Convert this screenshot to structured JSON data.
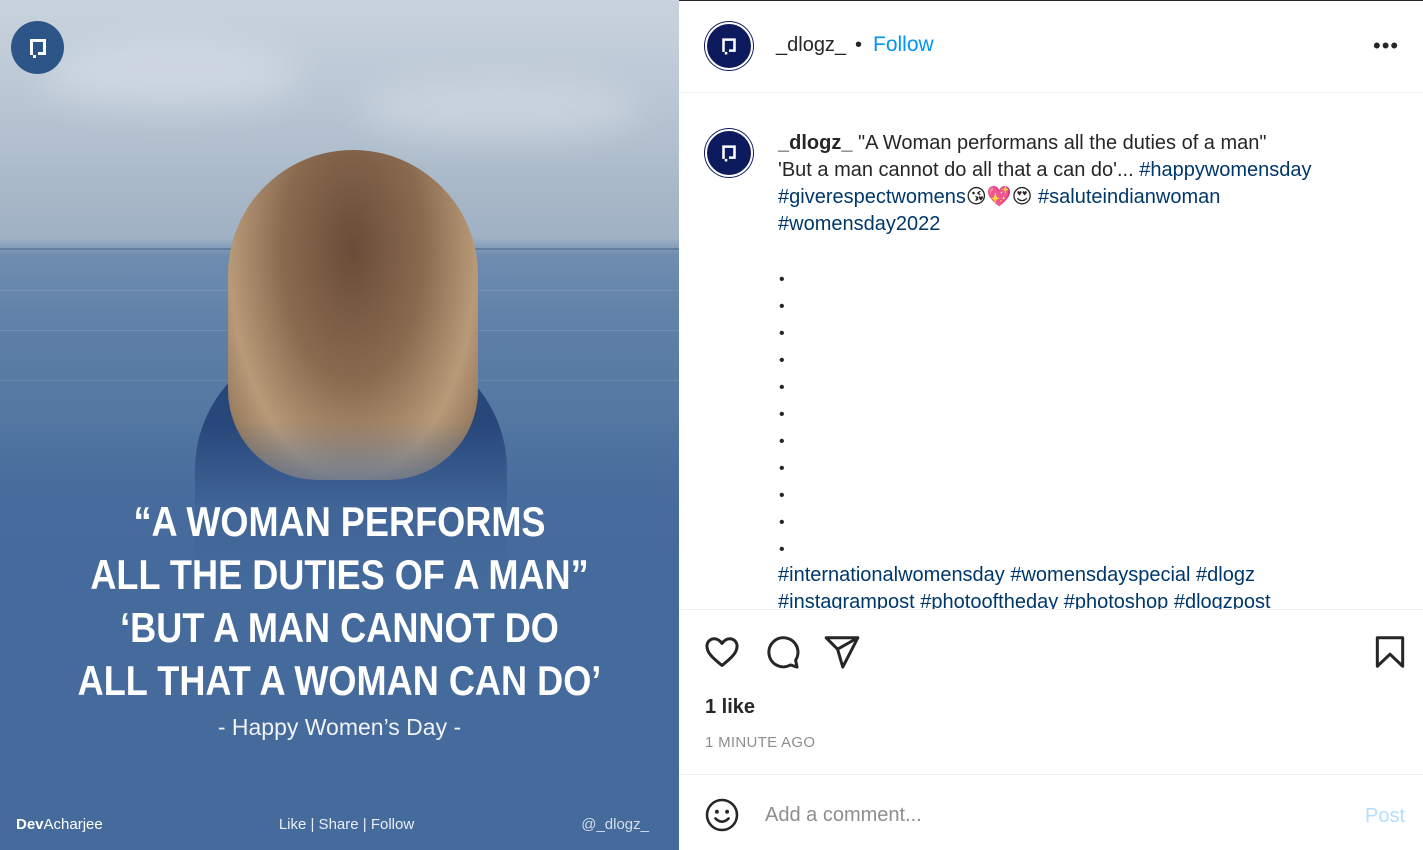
{
  "post_image": {
    "quote_lines": [
      "“A WOMAN PERFORMS",
      "ALL THE DUTIES OF A MAN”",
      "‘BUT A MAN CANNOT DO",
      "ALL THAT A WOMAN CAN DO’"
    ],
    "subtitle": "- Happy Women’s Day -",
    "credit_bold": "Dev",
    "credit_rest": "Acharjee",
    "footer_actions": "Like | Share | Follow",
    "footer_handle": "@_dlogz_"
  },
  "header": {
    "username": "_dlogz_",
    "separator": "•",
    "follow_label": "Follow",
    "more_label": "•••"
  },
  "caption": {
    "username": "_dlogz_",
    "text_line1": " \"A Woman performans all the duties of a man\"",
    "text_line2": "'But a man cannot do all that a can do'... ",
    "tag1": "#happywomensday",
    "tag2": "#giverespectwomens",
    "emojis": "😘💖😍",
    "tag3": "#saluteindianwoman",
    "tag4": "#womensday2022",
    "bullet_count": 11,
    "tags_bottom_line1": "#internationalwomensday #womensdayspecial #dlogz",
    "tags_bottom_line2": "#instagrampost #photooftheday #photoshop #dlogzpost"
  },
  "engagement": {
    "likes": "1 like",
    "time_ago": "1 MINUTE AGO"
  },
  "comment": {
    "placeholder": "Add a comment...",
    "post_label": "Post"
  },
  "colors": {
    "follow": "#0095f6",
    "hashtag": "#00376b",
    "post_disabled": "#b2dffc",
    "avatar_bg": "#0e1a5e"
  },
  "icons": [
    "logo-icon",
    "heart-icon",
    "comment-icon",
    "share-icon",
    "bookmark-icon",
    "emoji-icon",
    "more-icon"
  ]
}
